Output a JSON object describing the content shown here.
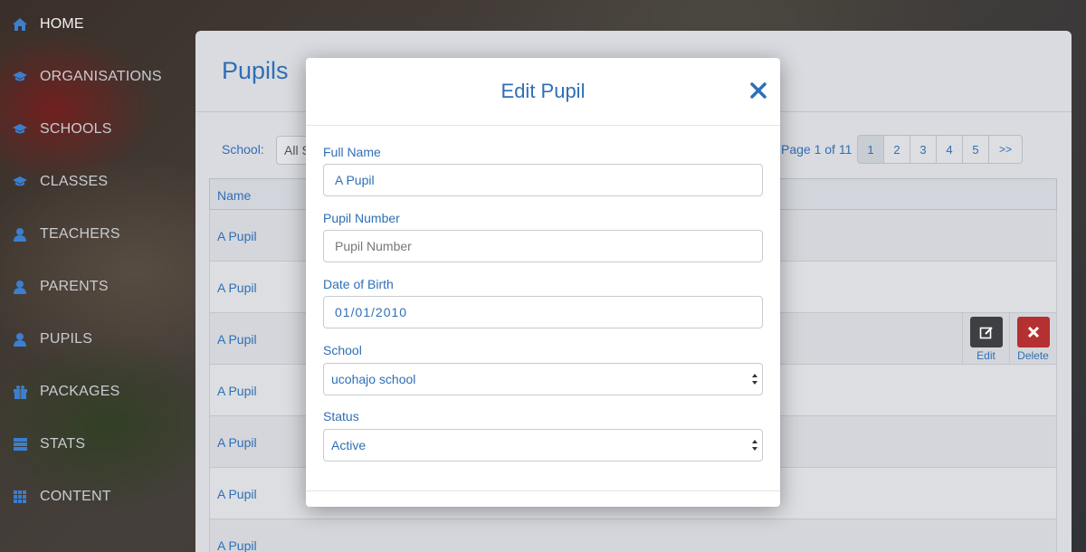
{
  "sidebar": {
    "items": [
      {
        "label": "HOME",
        "icon": "home-icon"
      },
      {
        "label": "ORGANISATIONS",
        "icon": "graduation-cap-icon"
      },
      {
        "label": "SCHOOLS",
        "icon": "graduation-cap-icon"
      },
      {
        "label": "CLASSES",
        "icon": "graduation-cap-icon"
      },
      {
        "label": "TEACHERS",
        "icon": "user-icon"
      },
      {
        "label": "PARENTS",
        "icon": "user-icon"
      },
      {
        "label": "PUPILS",
        "icon": "user-icon"
      },
      {
        "label": "PACKAGES",
        "icon": "gift-icon"
      },
      {
        "label": "STATS",
        "icon": "server-icon"
      },
      {
        "label": "CONTENT",
        "icon": "grid-icon"
      }
    ]
  },
  "main": {
    "title": "Pupils",
    "school_label": "School:",
    "school_select_value": "All S",
    "page_info": "Page 1 of 11",
    "pages": [
      "1",
      "2",
      "3",
      "4",
      "5",
      ">>"
    ],
    "table": {
      "header": "Name",
      "rows": [
        "A Pupil",
        "A Pupil",
        "A Pupil",
        "A Pupil",
        "A Pupil",
        "A Pupil",
        "A Pupil"
      ],
      "edit_label": "Edit",
      "delete_label": "Delete"
    }
  },
  "modal": {
    "title": "Edit Pupil",
    "fields": {
      "full_name_label": "Full Name",
      "full_name_value": "A Pupil",
      "pupil_number_label": "Pupil Number",
      "pupil_number_placeholder": "Pupil Number",
      "dob_label": "Date of Birth",
      "dob_value": "01/01/2010",
      "school_label": "School",
      "school_value": "ucohajo school",
      "status_label": "Status",
      "status_value": "Active"
    }
  },
  "colors": {
    "accent": "#2f6fb5",
    "edit_button": "#3d3f42",
    "delete_button": "#b53030"
  }
}
